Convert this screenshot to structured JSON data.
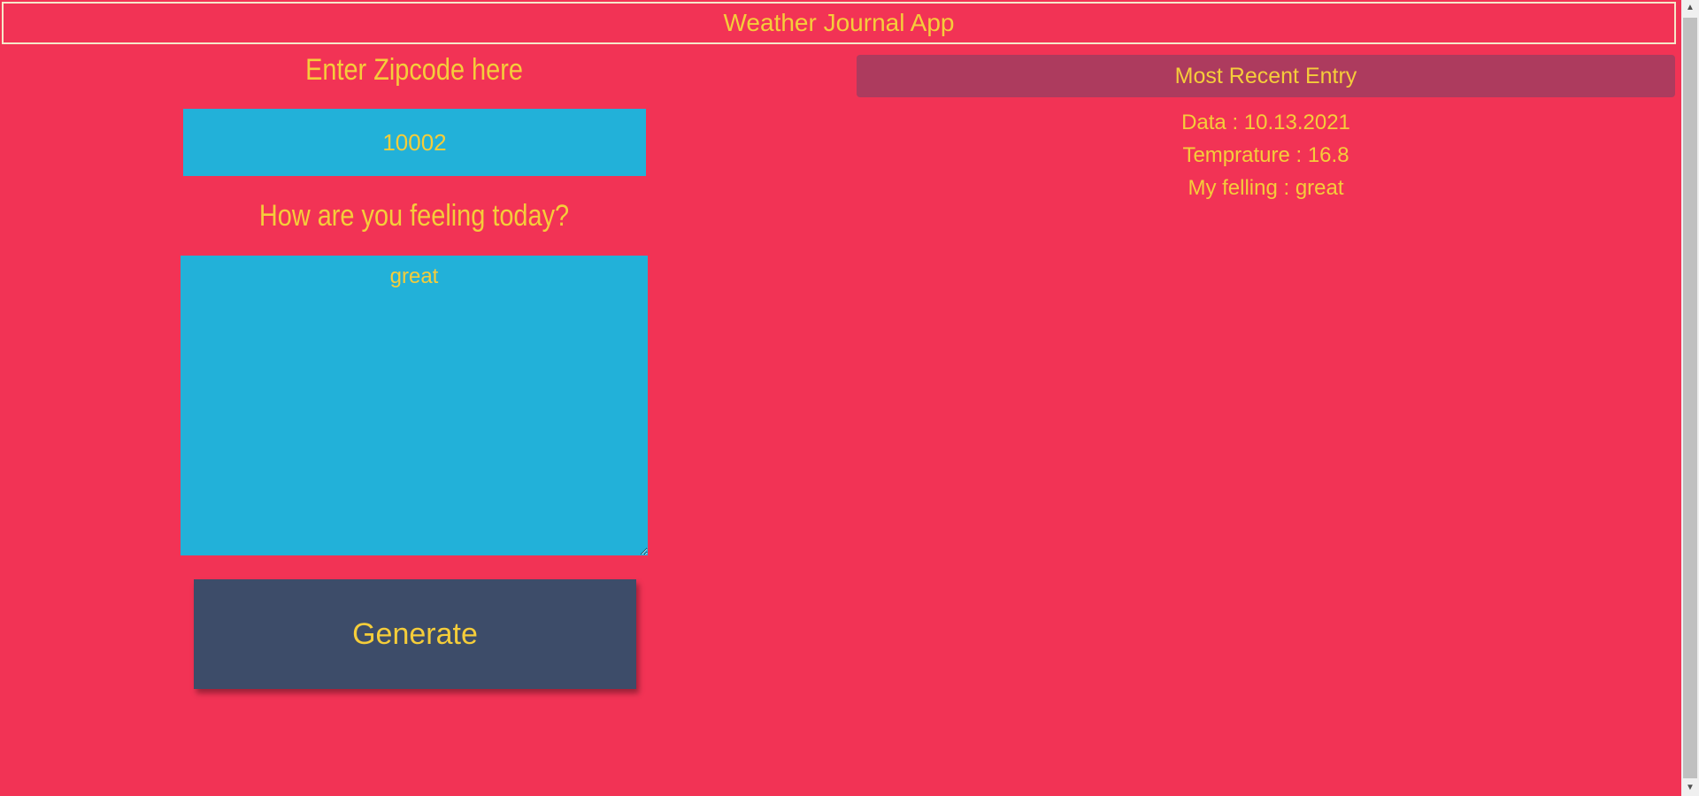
{
  "header": {
    "title": "Weather Journal App"
  },
  "form": {
    "zip_label": "Enter Zipcode here",
    "zip_value": "10002",
    "feeling_label": "How are you feeling today?",
    "feeling_value": "great",
    "generate_label": "Generate"
  },
  "entry": {
    "title": "Most Recent Entry",
    "date": "Data : 10.13.2021",
    "temp": "Temprature : 16.8",
    "content": "My felling : great"
  },
  "colors": {
    "background": "#f23355",
    "text": "#f5cd3a",
    "input_bg": "#22b1d9",
    "button_bg": "#3d4c69",
    "entry_title_bg": "#ad3b5e"
  },
  "icons": {
    "scroll_up": "chevron-up-icon",
    "scroll_down": "chevron-down-icon"
  }
}
